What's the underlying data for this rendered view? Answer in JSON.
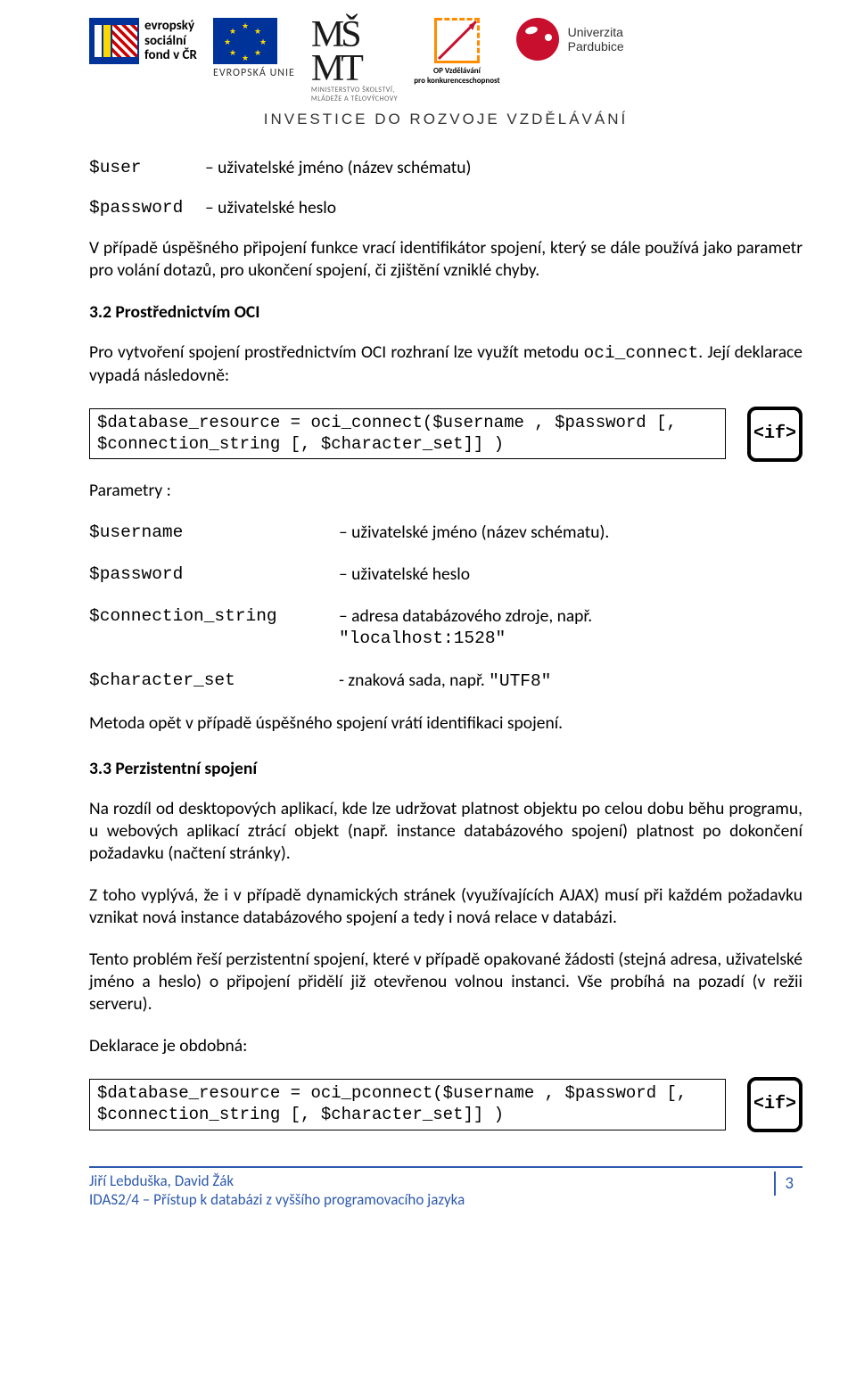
{
  "header": {
    "esf_label_1": "evropský",
    "esf_label_2": "sociální",
    "esf_label_3": "fond v ČR",
    "eu_label": "EVROPSKÁ UNIE",
    "msmt_line1": "MINISTERSTVO ŠKOLSTVÍ,",
    "msmt_line2": "MLÁDEŽE A TĚLOVÝCHOVY",
    "opvk_line1": "OP Vzdělávání",
    "opvk_line2": "pro konkurenceschopnost",
    "upa_line1": "Univerzita",
    "upa_line2": "Pardubice",
    "invest": "INVESTICE DO ROZVOJE VZDĚLÁVÁNÍ"
  },
  "if_icon_label": "<if>",
  "block1": {
    "user_var": "$user",
    "user_desc": "– uživatelské jméno (název schématu)",
    "pwd_var": "$password",
    "pwd_desc": "– uživatelské heslo",
    "para": "V případě úspěšného připojení funkce vrací identifikátor spojení, který se dále používá jako parametr pro volání dotazů, pro ukončení spojení, či zjištění vzniklé chyby."
  },
  "sec32": {
    "title": "3.2 Prostřednictvím OCI",
    "p1a": "Pro vytvoření spojení prostřednictvím OCI rozhraní lze využít metodu ",
    "p1b": "oci_connect",
    "p1c": ". Její deklarace vypadá následovně:",
    "code": "$database_resource = oci_connect($username , $password [, $connection_string [, $character_set]] )",
    "params_label": "Parametry :",
    "r1k": "$username",
    "r1v": "– uživatelské jméno (název schématu).",
    "r2k": "$password",
    "r2v": "– uživatelské heslo",
    "r3k": "$connection_string",
    "r3v1": "– adresa databázového zdroje, např.",
    "r3v2": "\"localhost:1528\"",
    "r4k": "$character_set",
    "r4v1": "- znaková sada, např. ",
    "r4v2": "\"UTF8\"",
    "p2": "Metoda opět v případě úspěšného spojení vrátí identifikaci spojení."
  },
  "sec33": {
    "title": "3.3 Perzistentní spojení",
    "p1": "Na rozdíl od desktopových aplikací, kde lze udržovat platnost objektu po celou dobu běhu programu, u webových aplikací ztrácí objekt (např. instance databázového spojení) platnost po dokončení požadavku (načtení stránky).",
    "p2": "Z toho vyplývá, že i v případě dynamických stránek (využívajících AJAX) musí při každém požadavku vznikat nová instance databázového spojení a tedy i nová relace v databázi.",
    "p3": "Tento problém řeší perzistentní spojení, které v případě opakované žádosti (stejná adresa, uživatelské jméno a heslo) o připojení přidělí již otevřenou volnou instanci. Vše probíhá na pozadí (v režii serveru).",
    "p4": "Deklarace je obdobná:",
    "code": "$database_resource = oci_pconnect($username , $password [, $connection_string [, $character_set]] )"
  },
  "footer": {
    "authors": "Jiří Lebduška, David Žák",
    "course": "IDAS2/4 – Přístup k databázi z vyššího programovacího jazyka",
    "page": "3"
  }
}
